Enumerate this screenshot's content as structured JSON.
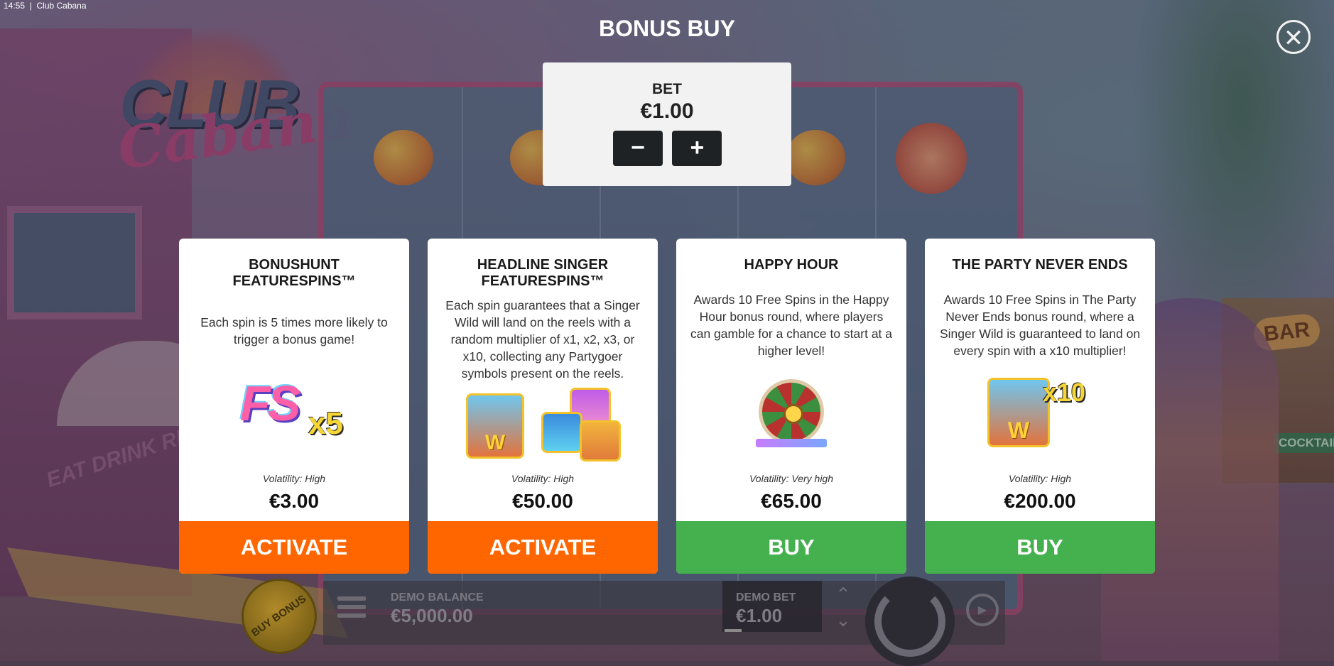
{
  "statusbar": {
    "time": "14:55",
    "app_title": "Club Cabana"
  },
  "background": {
    "logo_line1": "CLUB",
    "logo_line2": "Cabana",
    "bar_sign": "BAR",
    "cocktail_sign": "COCKTAIL",
    "wall_text": "EAT DRINK RELAX",
    "buy_bonus_disc": "BUY BONUS",
    "demo_balance_label": "DEMO BALANCE",
    "demo_balance_value": "€5,000.00",
    "demo_bet_label": "DEMO BET",
    "demo_bet_value": "€1.00"
  },
  "overlay": {
    "title": "BONUS BUY",
    "close_glyph": "✕",
    "bet": {
      "label": "BET",
      "value": "€1.00",
      "minus": "−",
      "plus": "+"
    },
    "cards": [
      {
        "title": "BONUSHUNT FEATURESPINS™",
        "description": "Each spin is 5 times more likely to trigger a bonus game!",
        "image_text": "FS",
        "image_multiplier": "x5",
        "volatility": "Volatility: High",
        "price": "€3.00",
        "button": "ACTIVATE",
        "button_color": "#ff6600"
      },
      {
        "title": "HEADLINE SINGER FEATURESPINS™",
        "description": "Each spin guarantees that a Singer Wild will land on the reels with a random multiplier of x1, x2, x3, or x10, collecting any Partygoer symbols present on the reels.",
        "image_badge": "W",
        "volatility": "Volatility: High",
        "price": "€50.00",
        "button": "ACTIVATE",
        "button_color": "#ff6600"
      },
      {
        "title": "HAPPY HOUR",
        "description": "Awards 10 Free Spins in the Happy Hour bonus round, where players can gamble for a chance to start at a higher level!",
        "volatility": "Volatility: Very high",
        "price": "€65.00",
        "button": "BUY",
        "button_color": "#44b04e"
      },
      {
        "title": "THE PARTY NEVER ENDS",
        "description": "Awards 10 Free Spins in The Party Never Ends bonus round, where a Singer Wild is guaranteed to land on every spin with a x10 multiplier!",
        "image_badge": "W",
        "image_multiplier": "x10",
        "volatility": "Volatility: High",
        "price": "€200.00",
        "button": "BUY",
        "button_color": "#44b04e"
      }
    ]
  }
}
